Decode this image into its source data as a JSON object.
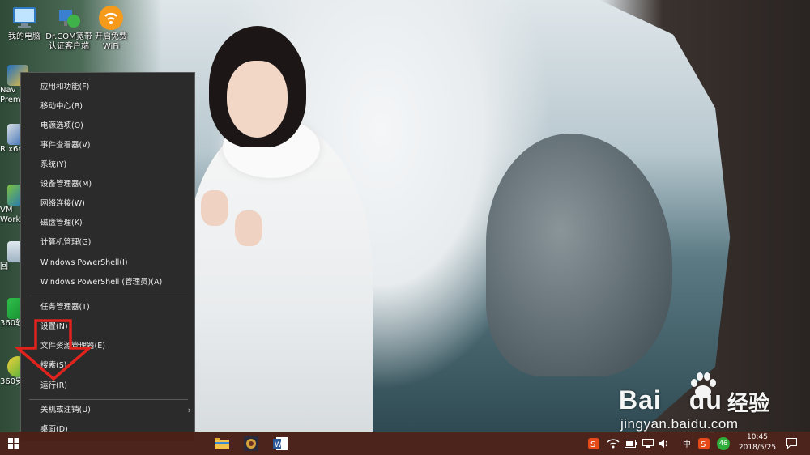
{
  "desktop": {
    "icons": [
      {
        "label": "我的电脑"
      },
      {
        "label": "Dr.COM宽带认证客户端"
      },
      {
        "label": "开启免费WiFi"
      }
    ],
    "partial_icons": [
      {
        "label": "Nav Premi"
      },
      {
        "label": "R x64"
      },
      {
        "label": "VM Work"
      },
      {
        "label": "回"
      },
      {
        "label": "360软"
      },
      {
        "label": "360安"
      }
    ]
  },
  "context_menu": {
    "items": [
      {
        "label": "应用和功能(F)"
      },
      {
        "label": "移动中心(B)"
      },
      {
        "label": "电源选项(O)"
      },
      {
        "label": "事件查看器(V)"
      },
      {
        "label": "系统(Y)"
      },
      {
        "label": "设备管理器(M)"
      },
      {
        "label": "网络连接(W)"
      },
      {
        "label": "磁盘管理(K)"
      },
      {
        "label": "计算机管理(G)"
      },
      {
        "label": "Windows PowerShell(I)"
      },
      {
        "label": "Windows PowerShell (管理员)(A)"
      },
      {
        "label": "任务管理器(T)"
      },
      {
        "label": "设置(N)"
      },
      {
        "label": "文件资源管理器(E)"
      },
      {
        "label": "搜索(S)"
      },
      {
        "label": "运行(R)"
      },
      {
        "label": "关机或注销(U)"
      },
      {
        "label": "桌面(D)"
      }
    ],
    "submenu_arrow": "›"
  },
  "taskbar": {
    "tray_input_method": "中",
    "tray_badge": "46",
    "clock_time": "10:45",
    "clock_date": "2018/5/25"
  },
  "watermark": {
    "brand": "Bai",
    "brand_suffix": "du",
    "product": "经验",
    "url": "jingyan.baidu.com"
  },
  "colors": {
    "menu_bg": "#2b2b2b",
    "taskbar_bg": "#4c2016",
    "annotation_red": "#e0231c"
  }
}
